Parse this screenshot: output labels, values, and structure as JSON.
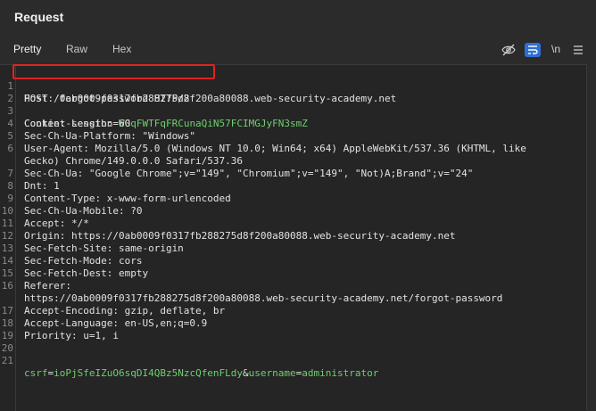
{
  "panel": {
    "title": "Request"
  },
  "tabs": [
    {
      "label": "Pretty",
      "active": true
    },
    {
      "label": "Raw",
      "active": false
    },
    {
      "label": "Hex",
      "active": false
    }
  ],
  "toolbar": {
    "eye_icon": "eye-slash-icon",
    "wrap_icon": "wrap-lines-icon",
    "newline_label": "\\n",
    "menu_icon": "hamburger-menu-icon"
  },
  "lines": [
    {
      "n": "1",
      "text": "POST /forgot-password HTTP/2"
    },
    {
      "n": "2",
      "text": "Host: 0ab0009f0317fb288275d8f200a80088.web-security-academy.net"
    },
    {
      "n": "3",
      "pre": "Cookie: session=",
      "val": "WGqFWTFqFRCunaQiN57FCIMGJyFN3smZ"
    },
    {
      "n": "4",
      "text": "Content-Length: 60"
    },
    {
      "n": "5",
      "text": "Sec-Ch-Ua-Platform: \"Windows\""
    },
    {
      "n": "6",
      "text": "User-Agent: Mozilla/5.0 (Windows NT 10.0; Win64; x64) AppleWebKit/537.36 (KHTML, like"
    },
    {
      "n": "",
      "text": "Gecko) Chrome/149.0.0.0 Safari/537.36"
    },
    {
      "n": "7",
      "text": "Sec-Ch-Ua: \"Google Chrome\";v=\"149\", \"Chromium\";v=\"149\", \"Not)A;Brand\";v=\"24\""
    },
    {
      "n": "8",
      "text": "Dnt: 1"
    },
    {
      "n": "9",
      "text": "Content-Type: x-www-form-urlencoded"
    },
    {
      "n": "10",
      "text": "Sec-Ch-Ua-Mobile: ?0"
    },
    {
      "n": "11",
      "text": "Accept: */*"
    },
    {
      "n": "12",
      "text": "Origin: https://0ab0009f0317fb288275d8f200a80088.web-security-academy.net"
    },
    {
      "n": "13",
      "text": "Sec-Fetch-Site: same-origin"
    },
    {
      "n": "14",
      "text": "Sec-Fetch-Mode: cors"
    },
    {
      "n": "15",
      "text": "Sec-Fetch-Dest: empty"
    },
    {
      "n": "16",
      "text": "Referer:"
    },
    {
      "n": "",
      "text": "https://0ab0009f0317fb288275d8f200a80088.web-security-academy.net/forgot-password"
    },
    {
      "n": "17",
      "text": "Accept-Encoding: gzip, deflate, br"
    },
    {
      "n": "18",
      "text": "Accept-Language: en-US,en;q=0.9"
    },
    {
      "n": "19",
      "text": "Priority: u=1, i"
    },
    {
      "n": "20",
      "text": ""
    },
    {
      "n": "21",
      "body": true,
      "k1": "csrf",
      "v1": "ioPjSfeIZuO6sqDI4QBz5NzcQfenFLdy",
      "amp": "&",
      "k2": "username",
      "v2": "administrator"
    }
  ],
  "colors": {
    "accent": "#2f6fd3",
    "highlight_box": "#e0231f",
    "param_value": "#6fcf6f"
  }
}
